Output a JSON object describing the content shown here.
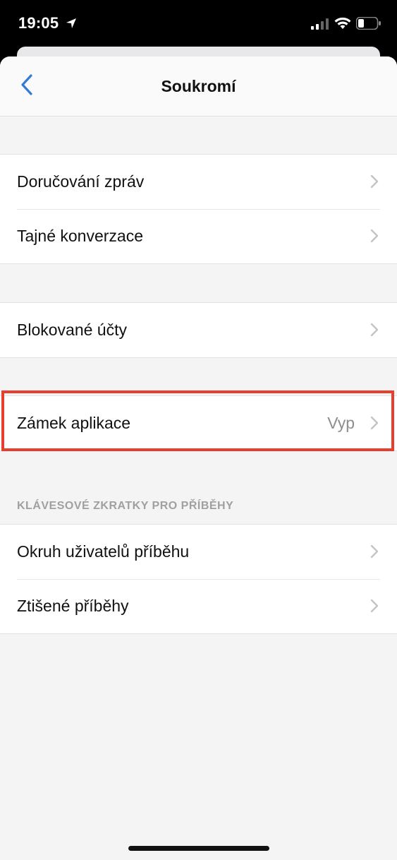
{
  "status_bar": {
    "time": "19:05"
  },
  "navbar": {
    "title": "Soukromí",
    "back_icon": "chevron-left-icon"
  },
  "groups": [
    {
      "items": [
        {
          "label": "Doručování zpráv"
        },
        {
          "label": "Tajné konverzace"
        }
      ]
    },
    {
      "items": [
        {
          "label": "Blokované účty"
        }
      ]
    },
    {
      "items": [
        {
          "label": "Zámek aplikace",
          "value": "Vyp"
        }
      ]
    },
    {
      "header": "KLÁVESOVÉ ZKRATKY PRO PŘÍBĚHY",
      "items": [
        {
          "label": "Okruh uživatelů příběhu"
        },
        {
          "label": "Ztišené příběhy"
        }
      ]
    }
  ],
  "colors": {
    "accent": "#2f7bd6",
    "highlight": "#e5402f",
    "background": "#f4f4f4"
  }
}
